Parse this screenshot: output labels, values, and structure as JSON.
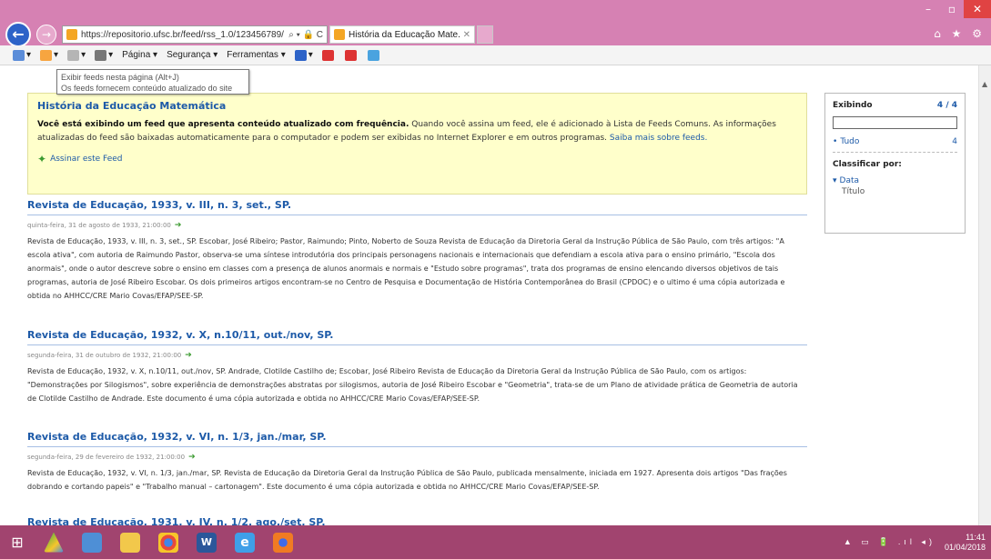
{
  "browser": {
    "address": "https://repositorio.ufsc.br/feed/rss_1.0/123456789/",
    "address_controls": "⌕ ▾ 🔒 C",
    "tab_title": "História da Educação Mate...",
    "tab_close": "✕",
    "window_controls": [
      "–",
      "▫",
      "✕"
    ],
    "right_icons": "⌂ ★ ⚙"
  },
  "command_bar": {
    "items": [
      {
        "label": "",
        "icon": "home-icon"
      },
      {
        "label": "",
        "icon": "feed-icon"
      },
      {
        "label": "",
        "icon": "mail-icon"
      },
      {
        "label": "",
        "icon": "print-icon"
      },
      {
        "label": "Página ▾",
        "icon": ""
      },
      {
        "label": "Segurança ▾",
        "icon": ""
      },
      {
        "label": "Ferramentas ▾",
        "icon": ""
      },
      {
        "label": "",
        "icon": "help-icon"
      }
    ]
  },
  "tooltip": {
    "line1": "Exibir feeds nesta página (Alt+J)",
    "line2": "Os feeds fornecem conteúdo atualizado do site"
  },
  "feed": {
    "title": "História da Educação Matemática",
    "desc_bold": "Você está exibindo um feed que apresenta conteúdo atualizado com frequência.",
    "desc_text": " Quando você assina um feed, ele é adicionado à Lista de Feeds Comuns. As informações atualizadas do feed são baixadas automaticamente para o computador e podem ser exibidas no Internet Explorer e em outros programas. ",
    "desc_link": "Saiba mais sobre feeds.",
    "subscribe_label": "Assinar este Feed"
  },
  "side_panel": {
    "showing_label": "Exibindo",
    "showing_count": "4 / 4",
    "search_value": "",
    "all_label": "Tudo",
    "all_count": "4",
    "sort_label": "Classificar por:",
    "sort_options": [
      "Data",
      "Título"
    ]
  },
  "articles": [
    {
      "title": "Revista de Educação, 1933, v. III, n. 3, set., SP.",
      "date": "quinta-feira, 31 de agosto de 1933, 21:00:00",
      "body": "Revista de Educação, 1933, v. III, n. 3, set., SP. Escobar, José Ribeiro; Pastor, Raimundo; Pinto, Noberto de Souza Revista de Educação da Diretoria Geral da Instrução Pública de São Paulo, com três artigos: \"A escola ativa\", com autoria de Raimundo Pastor, observa-se uma síntese introdutória dos principais personagens nacionais e internacionais que defendiam a escola ativa para o ensino primário, \"Escola dos anormais\", onde o autor descreve sobre o ensino em classes com a presença de alunos anormais e normais e \"Estudo sobre programas\", trata dos programas de ensino elencando diversos objetivos de tais programas, autoria de José Ribeiro Escobar. Os dois primeiros artigos encontram-se no Centro de Pesquisa e Documentação de História Contemporânea do Brasil (CPDOC) e o ultimo é uma cópia autorizada e obtida no AHHCC/CRE Mario Covas/EFAP/SEE-SP."
    },
    {
      "title": "Revista de Educação, 1932, v. X, n.10/11, out./nov, SP.",
      "date": "segunda-feira, 31 de outubro de 1932, 21:00:00",
      "body": "Revista de Educação, 1932, v. X, n.10/11, out./nov, SP. Andrade, Clotilde Castilho de; Escobar, José Ribeiro Revista de Educação da Diretoria Geral da Instrução Pública de São Paulo, com os artigos: \"Demonstrações por Silogismos\", sobre experiência de demonstrações abstratas por silogismos, autoria de José Ribeiro Escobar e \"Geometria\", trata-se de um Plano de atividade prática de Geometria de autoria de Clotilde Castilho de Andrade. Este documento é uma cópia autorizada e obtida no AHHCC/CRE Mario Covas/EFAP/SEE-SP."
    },
    {
      "title": "Revista de Educação, 1932, v. VI, n. 1/3, jan./mar, SP.",
      "date": "segunda-feira, 29 de fevereiro de 1932, 21:00:00",
      "body": "Revista de Educação, 1932, v. VI, n. 1/3, jan./mar, SP. Revista de Educação da Diretoria Geral da Instrução Pública de São Paulo, publicada mensalmente, iniciada em 1927. Apresenta dois artigos \"Das frações dobrando e cortando papeis\" e \"Trabalho manual – cartonagem\". Este documento é uma cópia autorizada e obtida no AHHCC/CRE Mario Covas/EFAP/SEE-SP."
    },
    {
      "title": "Revista de Educação, 1931, v. IV, n. 1/2, ago./set, SP.",
      "date": "",
      "body": ""
    }
  ],
  "taskbar": {
    "start_glyph": "⊞",
    "word_glyph": "W",
    "ie_glyph": "e",
    "system_tray": "▲ ▭ 🔋 .ıl ◂)",
    "time": "11:41",
    "date": "01/04/2018"
  }
}
